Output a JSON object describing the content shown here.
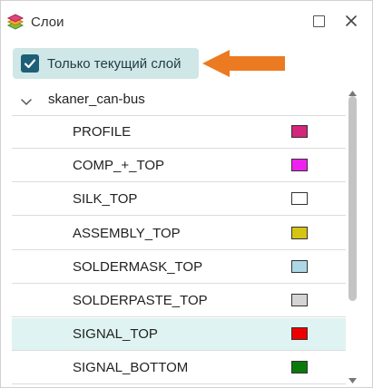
{
  "window": {
    "title": "Слои",
    "app_icon": "layers-icon",
    "maximize_icon": "maximize-icon",
    "close_icon": "close-icon"
  },
  "filter": {
    "label": "Только текущий слой",
    "checked": true
  },
  "tree": {
    "group": {
      "label": "skaner_can-bus",
      "expanded": true
    },
    "layers": [
      {
        "label": "PROFILE",
        "color": "#d4267a",
        "selected": false
      },
      {
        "label": "COMP_+_TOP",
        "color": "#ee22ee",
        "selected": false
      },
      {
        "label": "SILK_TOP",
        "color": "#ffffff",
        "selected": false
      },
      {
        "label": "ASSEMBLY_TOP",
        "color": "#d4c414",
        "selected": false
      },
      {
        "label": "SOLDERMASK_TOP",
        "color": "#acd8e6",
        "selected": false
      },
      {
        "label": "SOLDERPASTE_TOP",
        "color": "#d4d4d4",
        "selected": false
      },
      {
        "label": "SIGNAL_TOP",
        "color": "#ee0000",
        "selected": true
      },
      {
        "label": "SIGNAL_BOTTOM",
        "color": "#0a7a0a",
        "selected": false
      }
    ]
  },
  "colors": {
    "accent": "#1e5f78",
    "chip_background": "#cfe7e6",
    "selected_row": "#dff3f2",
    "callout_arrow": "#ec7a20"
  }
}
